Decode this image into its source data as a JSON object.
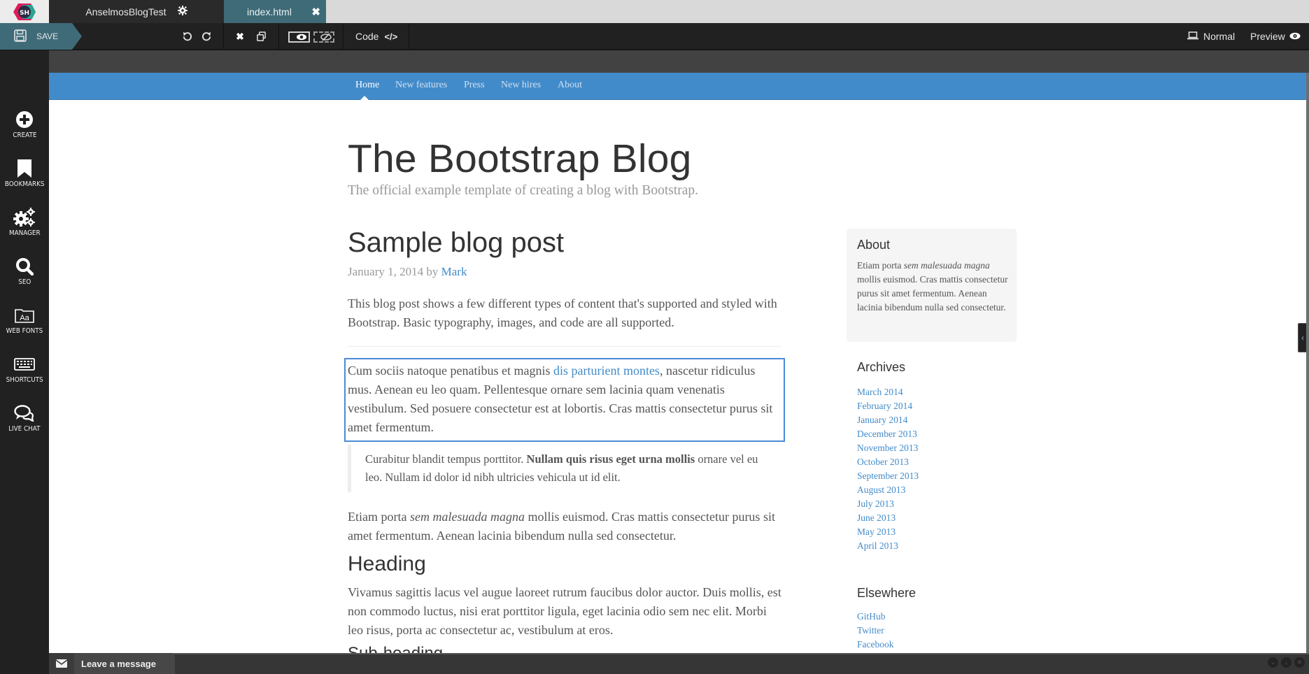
{
  "tabs": {
    "project_name": "AnselmosBlogTest",
    "file_name": "index.html"
  },
  "toolbar": {
    "save_label": "SAVE",
    "code_label": "Code",
    "normal_label": "Normal",
    "preview_label": "Preview"
  },
  "sidebar": {
    "items": [
      {
        "label": "CREATE",
        "icon": "plus-circle-icon"
      },
      {
        "label": "BOOKMARKS",
        "icon": "bookmark-icon"
      },
      {
        "label": "MANAGER",
        "icon": "gears-icon"
      },
      {
        "label": "SEO",
        "icon": "search-icon"
      },
      {
        "label": "WEB FONTS",
        "icon": "font-folder-icon"
      },
      {
        "label": "SHORTCUTS",
        "icon": "keyboard-icon"
      },
      {
        "label": "LIVE CHAT",
        "icon": "chat-bubbles-icon"
      }
    ]
  },
  "blog": {
    "nav": [
      "Home",
      "New features",
      "Press",
      "New hires",
      "About"
    ],
    "title": "The Bootstrap Blog",
    "description": "The official example template of creating a blog with Bootstrap.",
    "post": {
      "title": "Sample blog post",
      "date": "January 1, 2014 by ",
      "author": "Mark",
      "intro": "This blog post shows a few different types of content that's supported and styled with Bootstrap. Basic typography, images, and code are all supported.",
      "p1_before": "Cum sociis natoque penatibus et magnis ",
      "p1_link": "dis parturient montes",
      "p1_after": ", nascetur ridiculus mus. Aenean eu leo quam. Pellentesque ornare sem lacinia quam venenatis vestibulum. Sed posuere consectetur est at lobortis. Cras mattis consectetur purus sit amet fermentum.",
      "quote_before": "Curabitur blandit tempus porttitor. ",
      "quote_bold": "Nullam quis risus eget urna mollis",
      "quote_after": " ornare vel eu leo. Nullam id dolor id nibh ultricies vehicula ut id elit.",
      "p2_before": "Etiam porta ",
      "p2_em": "sem malesuada magna",
      "p2_after": " mollis euismod. Cras mattis consectetur purus sit amet fermentum. Aenean lacinia bibendum nulla sed consectetur.",
      "heading": "Heading",
      "p3": "Vivamus sagittis lacus vel augue laoreet rutrum faucibus dolor auctor. Duis mollis, est non commodo luctus, nisi erat porttitor ligula, eget lacinia odio sem nec elit. Morbi leo risus, porta ac consectetur ac, vestibulum at eros.",
      "subheading": "Sub-heading"
    },
    "about": {
      "title": "About",
      "text_before": "Etiam porta ",
      "text_em": "sem malesuada magna",
      "text_after": " mollis euismod. Cras mattis consectetur purus sit amet fermentum. Aenean lacinia bibendum nulla sed consectetur."
    },
    "archives": {
      "title": "Archives",
      "items": [
        "March 2014",
        "February 2014",
        "January 2014",
        "December 2013",
        "November 2013",
        "October 2013",
        "September 2013",
        "August 2013",
        "July 2013",
        "June 2013",
        "May 2013",
        "April 2013"
      ]
    },
    "elsewhere": {
      "title": "Elsewhere",
      "items": [
        "GitHub",
        "Twitter",
        "Facebook"
      ]
    }
  },
  "chat": {
    "label": "Leave a message"
  },
  "colors": {
    "accent": "#3f6b78",
    "bootstrap_primary": "#428bca",
    "selection": "#4a8bd6"
  }
}
